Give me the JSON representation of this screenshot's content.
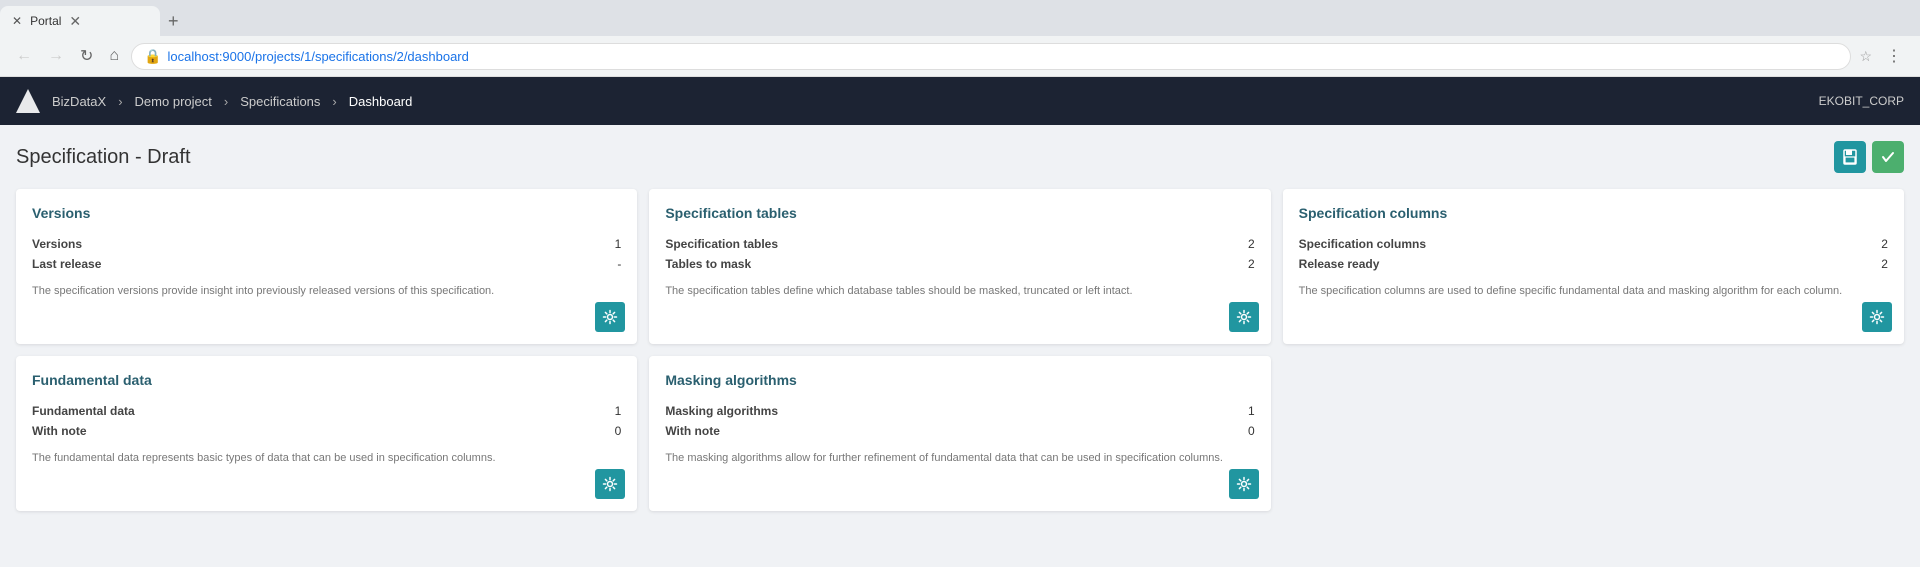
{
  "browser": {
    "tab_title": "Portal",
    "tab_favicon": "✕",
    "url": "localhost:9000/projects/1/specifications/2/dashboard",
    "nav": {
      "back_title": "Back",
      "forward_title": "Forward",
      "reload_title": "Reload",
      "home_title": "Home"
    }
  },
  "navbar": {
    "logo_alt": "BizDataX logo",
    "breadcrumbs": [
      {
        "label": "BizDataX",
        "href": "#"
      },
      {
        "label": "Demo project",
        "href": "#"
      },
      {
        "label": "Specifications",
        "href": "#"
      },
      {
        "label": "Dashboard",
        "current": true
      }
    ],
    "user": "EKOBIT_CORP"
  },
  "page": {
    "title": "Specification - Draft",
    "save_label": "💾",
    "confirm_label": "✓",
    "cards": [
      {
        "id": "versions",
        "title": "Versions",
        "stats": [
          {
            "label": "Versions",
            "value": "1"
          },
          {
            "label": "Last release",
            "value": "-"
          }
        ],
        "description": "The specification versions provide insight into previously released versions of this specification."
      },
      {
        "id": "specification-tables",
        "title": "Specification tables",
        "stats": [
          {
            "label": "Specification tables",
            "value": "2"
          },
          {
            "label": "Tables to mask",
            "value": "2"
          }
        ],
        "description": "The specification tables define which database tables should be masked, truncated or left intact."
      },
      {
        "id": "specification-columns",
        "title": "Specification columns",
        "stats": [
          {
            "label": "Specification columns",
            "value": "2"
          },
          {
            "label": "Release ready",
            "value": "2"
          }
        ],
        "description": "The specification columns are used to define specific fundamental data and masking algorithm for each column."
      },
      {
        "id": "fundamental-data",
        "title": "Fundamental data",
        "stats": [
          {
            "label": "Fundamental data",
            "value": "1"
          },
          {
            "label": "With note",
            "value": "0"
          }
        ],
        "description": "The fundamental data represents basic types of data that can be used in specification columns."
      },
      {
        "id": "masking-algorithms",
        "title": "Masking algorithms",
        "stats": [
          {
            "label": "Masking algorithms",
            "value": "1"
          },
          {
            "label": "With note",
            "value": "0"
          }
        ],
        "description": "The masking algorithms allow for further refinement of fundamental data that can be used in specification columns."
      }
    ]
  }
}
